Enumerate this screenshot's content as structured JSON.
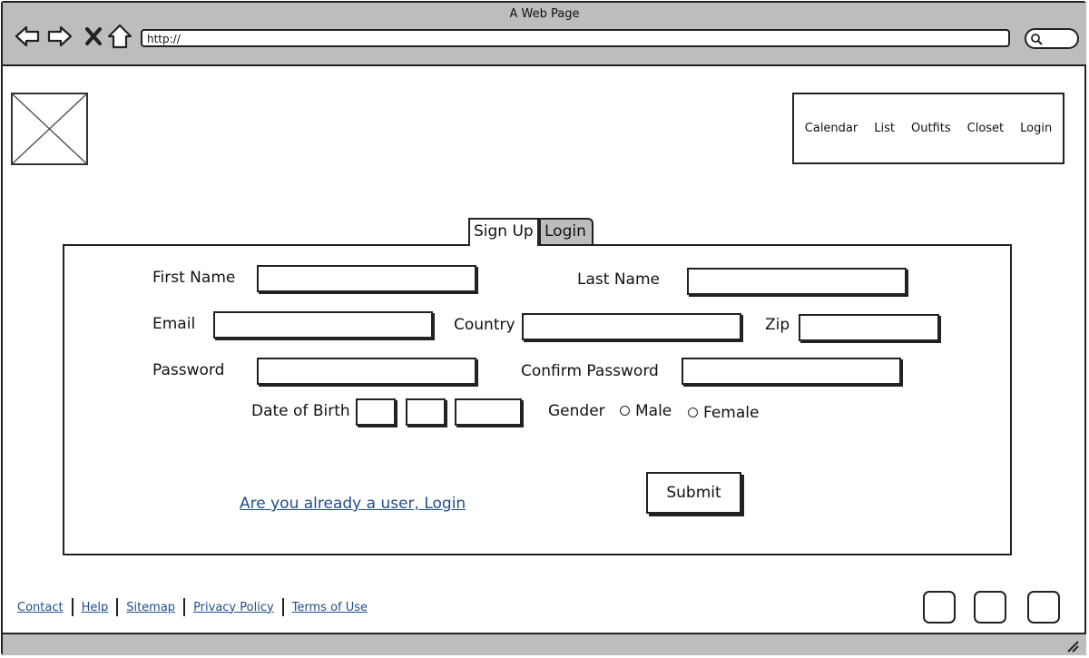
{
  "window": {
    "title": "A Web Page"
  },
  "browser": {
    "url": "http://",
    "icons": [
      "back-arrow-icon",
      "forward-arrow-icon",
      "close-x-icon",
      "home-icon",
      "search-icon"
    ]
  },
  "header": {
    "nav_items": [
      "Calendar",
      "List",
      "Outfits",
      "Closet",
      "Login"
    ]
  },
  "tabs": [
    {
      "label": "Sign Up",
      "active": true
    },
    {
      "label": "Login",
      "active": false
    }
  ],
  "form": {
    "first_name_label": "First Name",
    "last_name_label": "Last Name",
    "email_label": "Email",
    "country_label": "Country",
    "zip_label": "Zip",
    "password_label": "Password",
    "confirm_password_label": "Confirm Password",
    "dob_label": "Date of Birth",
    "gender_label": "Gender",
    "gender_options": [
      "Male",
      "Female"
    ],
    "login_link": "Are you already a user, Login",
    "submit_label": "Submit"
  },
  "footer": {
    "links": [
      "Contact",
      "Help",
      "Sitemap",
      "Privacy Policy",
      "Terms of Use"
    ]
  },
  "colors": {
    "chrome_gray": "#bdbdbd",
    "link_blue": "#1f4e8c",
    "ink": "#222222"
  }
}
